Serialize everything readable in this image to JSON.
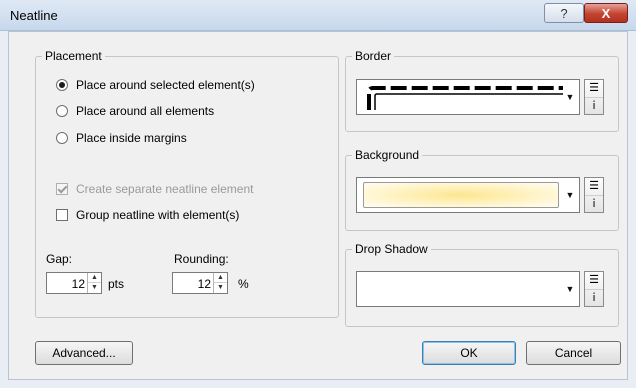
{
  "window": {
    "title": "Neatline",
    "help_glyph": "?",
    "close_glyph": "X"
  },
  "placement": {
    "legend": "Placement",
    "options": [
      {
        "label": "Place around selected element(s)",
        "selected": true
      },
      {
        "label": "Place around all elements",
        "selected": false
      },
      {
        "label": "Place inside margins",
        "selected": false
      }
    ],
    "create_separate": {
      "label": "Create separate neatline element",
      "checked": true,
      "enabled": false
    },
    "group_with": {
      "label": "Group neatline with element(s)",
      "checked": false
    },
    "gap": {
      "label": "Gap:",
      "value": "12",
      "unit": "pts"
    },
    "rounding": {
      "label": "Rounding:",
      "value": "12",
      "unit": "%"
    }
  },
  "border": {
    "legend": "Border"
  },
  "background": {
    "legend": "Background",
    "color": "#fde690"
  },
  "drop_shadow": {
    "legend": "Drop Shadow"
  },
  "buttons": {
    "advanced": "Advanced...",
    "ok": "OK",
    "cancel": "Cancel"
  },
  "icons": {
    "properties": "list-icon",
    "symbol": "info-icon",
    "dropdown": "chevron-down-icon"
  },
  "colors": {
    "accent": "#3c7fb1",
    "close": "#c2432f"
  }
}
